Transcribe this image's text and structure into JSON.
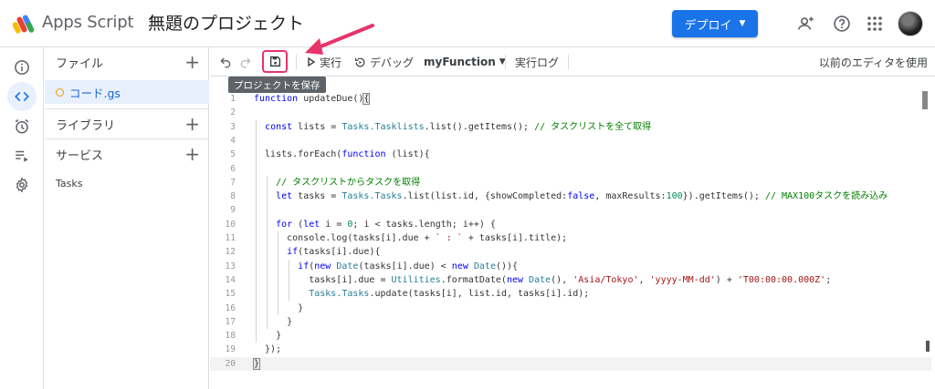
{
  "header": {
    "app_name": "Apps Script",
    "project_title": "無題のプロジェクト",
    "deploy_label": "デプロイ",
    "icons": [
      "add-person-icon",
      "help-icon",
      "apps-grid-icon"
    ]
  },
  "rail": {
    "items": [
      {
        "name": "overview",
        "icon": "info-icon"
      },
      {
        "name": "editor",
        "icon": "code-icon",
        "active": true
      },
      {
        "name": "triggers",
        "icon": "alarm-icon"
      },
      {
        "name": "executions",
        "icon": "list-play-icon"
      },
      {
        "name": "settings",
        "icon": "gear-icon"
      }
    ]
  },
  "panel": {
    "files_label": "ファイル",
    "file_name": "コード.gs",
    "libraries_label": "ライブラリ",
    "services_label": "サービス",
    "service_item": "Tasks"
  },
  "toolbar": {
    "run_label": "実行",
    "debug_label": "デバッグ",
    "function_name": "myFunction",
    "log_label": "実行ログ",
    "legacy_label": "以前のエディタを使用",
    "tooltip": "プロジェクトを保存"
  },
  "editor": {
    "lines": [
      "function updateDue(){",
      "",
      "  const lists = Tasks.Tasklists.list().getItems(); // タスクリストを全て取得",
      "",
      "  lists.forEach(function (list){",
      "",
      "    // タスクリストからタスクを取得",
      "    let tasks = Tasks.Tasks.list(list.id, {showCompleted:false, maxResults:100}).getItems(); // MAX100タスクを読み込み",
      "",
      "    for (let i = 0; i < tasks.length; i++) {",
      "      console.log(tasks[i].due + ` : ` + tasks[i].title);",
      "      if(tasks[i].due){",
      "        if(new Date(tasks[i].due) < new Date()){",
      "          tasks[i].due = Utilities.formatDate(new Date(), 'Asia/Tokyo', 'yyyy-MM-dd') + 'T00:00:00.000Z';",
      "          Tasks.Tasks.update(tasks[i], list.id, tasks[i].id);",
      "        }",
      "      }",
      "    }",
      "  });",
      "}"
    ],
    "line_numbers": [
      "1",
      "2",
      "3",
      "4",
      "5",
      "6",
      "7",
      "8",
      "9",
      "10",
      "11",
      "12",
      "13",
      "14",
      "15",
      "16",
      "17",
      "18",
      "19",
      "20"
    ]
  },
  "colors": {
    "accent": "#1a73e8",
    "highlight_box": "#e8336b",
    "file_dot": "#f29900"
  }
}
